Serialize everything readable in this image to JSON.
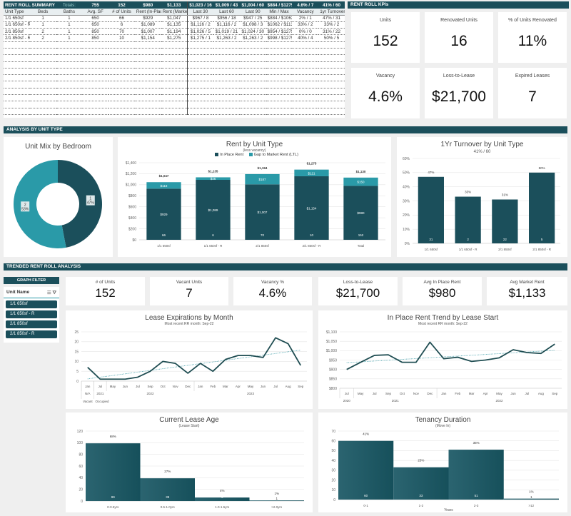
{
  "colors": {
    "dark_teal": "#1b4f5b",
    "light_teal": "#2a9aa8",
    "background": "#efefef"
  },
  "rent_roll": {
    "title": "RENT ROLL SUMMARY",
    "totals_label": "Totals:",
    "totals": [
      "755",
      "152",
      "$980",
      "$1,133",
      "$1,023 / 16",
      "$1,009 / 43",
      "$1,004 / 60",
      "$884 / $1275",
      "4.6% / 7",
      "41% / 60"
    ],
    "columns": [
      "Unit Type",
      "Beds",
      "Baths",
      "Avg. SF",
      "# of Units",
      "Rent (In-Place)",
      "Rent (Market)",
      "Last 30",
      "Last 60",
      "Last 90",
      "Min / Max",
      "Vacancy",
      "1yr Turnover"
    ],
    "rows": [
      [
        "1/1 650sf",
        "1",
        "1",
        "650",
        "66",
        "$929",
        "$1,047",
        "$967 / 8",
        "$956 / 18",
        "$947 / 25",
        "$884 / $1062",
        "2% / 1",
        "47% / 31"
      ],
      [
        "1/1 650sf - R",
        "1",
        "1",
        "650",
        "6",
        "$1,089",
        "$1,135",
        "$1,116 / 2",
        "$1,116 / 2",
        "$1,098 / 3",
        "$1062 / $1135",
        "33% / 2",
        "33% / 2"
      ],
      [
        "2/1 850sf",
        "2",
        "1",
        "850",
        "70",
        "$1,007",
        "$1,194",
        "$1,026 / 5",
        "$1,019 / 21",
        "$1,024 / 30",
        "$954 / $1275",
        "0% / 0",
        "31% / 22"
      ],
      [
        "2/1 850sf - R",
        "2",
        "1",
        "850",
        "10",
        "$1,154",
        "$1,275",
        "$1,275 / 1",
        "$1,263 / 2",
        "$1,263 / 2",
        "$998 / $1275",
        "40% / 4",
        "50% / 5"
      ]
    ]
  },
  "kpis": {
    "title": "RENT ROLL KPIs",
    "cards": [
      {
        "label": "Units",
        "value": "152"
      },
      {
        "label": "Renovated Units",
        "value": "16"
      },
      {
        "label": "% of Units Renovated",
        "value": "11%"
      },
      {
        "label": "Vacancy",
        "value": "4.6%"
      },
      {
        "label": "Loss-to-Lease",
        "value": "$21,700"
      },
      {
        "label": "Expired Leases",
        "value": "7"
      }
    ]
  },
  "section_unit_type": "ANALYSIS BY UNIT TYPE",
  "section_trended": "TRENDED RENT ROLL ANALYSIS",
  "graph_filter": {
    "title": "GRAPH FILTER",
    "field": "Unit Name",
    "items": [
      "1/1 650sf",
      "1/1 650sf - R",
      "2/1 850sf",
      "2/1 850sf - R"
    ]
  },
  "trend_kpis": [
    {
      "label": "# of Units",
      "value": "152"
    },
    {
      "label": "Vacant Units",
      "value": "7"
    },
    {
      "label": "Vacancy %",
      "value": "4.6%"
    },
    {
      "label": "Loss-to-Lease",
      "value": "$21,700"
    },
    {
      "label": "Avg In Place Rent",
      "value": "$980"
    },
    {
      "label": "Avg Market Rent",
      "value": "$1,133"
    }
  ],
  "chart_data": [
    {
      "id": "unit_mix",
      "type": "pie",
      "donut": true,
      "title": "Unit Mix by Bedroom",
      "categories": [
        "1",
        "2"
      ],
      "values": [
        47,
        53
      ],
      "labels": [
        "47%",
        "53%"
      ],
      "colors": [
        "#1b4f5b",
        "#2a9aa8"
      ]
    },
    {
      "id": "rent_by_type",
      "type": "bar",
      "stacked": true,
      "title": "Rent by Unit Type",
      "subtitle": "(less vacancy)",
      "legend_position": "top",
      "categories": [
        "1/1 650sf",
        "1/1 650sf - R",
        "2/1 850sf",
        "2/1 850sf - R",
        "Total"
      ],
      "series": [
        {
          "name": "In Place Rent",
          "values": [
            929,
            1089,
            1007,
            1154,
            980
          ],
          "labels": [
            "$929",
            "$1,089",
            "$1,007",
            "$1,154",
            "$980"
          ],
          "color": "#1b4f5b"
        },
        {
          "name": "Gap to Market Rent (LTL)",
          "values": [
            118,
            46,
            187,
            121,
            150
          ],
          "labels": [
            "$118",
            "$46",
            "$187",
            "$121",
            "$150"
          ],
          "color": "#2a9aa8"
        }
      ],
      "total_labels": [
        "$1,047",
        "$1,135",
        "$1,194",
        "$1,275",
        "$1,130"
      ],
      "unit_counts": [
        "66",
        "6",
        "70",
        "10",
        "152"
      ],
      "yticks": [
        "$0",
        "$200",
        "$400",
        "$600",
        "$800",
        "$1,000",
        "$1,200",
        "$1,400"
      ],
      "ylim": [
        0,
        1400
      ],
      "grid": true
    },
    {
      "id": "turnover",
      "type": "bar",
      "title": "1Yr Turnover by Unit Type",
      "subtitle": "41% / 60",
      "categories": [
        "1/1 650sf",
        "1/1 650sf - R",
        "2/1 850sf",
        "2/1 850sf - R"
      ],
      "values": [
        47,
        33,
        31,
        50
      ],
      "labels": [
        "47%",
        "33%",
        "31%",
        "50%"
      ],
      "counts": [
        "31",
        "2",
        "22",
        "5"
      ],
      "yticks": [
        "0%",
        "10%",
        "20%",
        "30%",
        "40%",
        "50%",
        "60%"
      ],
      "ylim": [
        0,
        60
      ],
      "grid": true
    },
    {
      "id": "lease_exp",
      "type": "line",
      "title": "Lease Expirations by Month",
      "subtitle": "Most recent RR month: Sep-22",
      "trendline": "linear",
      "x": [
        "Jan",
        "Jul",
        "May",
        "Jun",
        "Jul",
        "Sep",
        "Oct",
        "Nov",
        "Dec",
        "Jan",
        "Feb",
        "Mar",
        "Apr",
        "May",
        "Jun",
        "Jul",
        "Aug",
        "Sep"
      ],
      "x_groups": [
        {
          "label": "N/A",
          "span": 1
        },
        {
          "label": "2021",
          "span": 1
        },
        {
          "label": "2022",
          "span": 7
        },
        {
          "label": "2023",
          "span": 9
        }
      ],
      "x_groups2": [
        {
          "label": "Vacant",
          "span": 1
        },
        {
          "label": "Occupied",
          "span": 17
        }
      ],
      "values": [
        7,
        1,
        1,
        1,
        2,
        5,
        10,
        9,
        4,
        9,
        5,
        11,
        13,
        13,
        12,
        22,
        19,
        8
      ],
      "yticks": [
        "0",
        "5",
        "10",
        "15",
        "20",
        "25"
      ],
      "ylim": [
        0,
        25
      ],
      "grid": true
    },
    {
      "id": "rent_trend",
      "type": "line",
      "title": "In Place Rent Trend by Lease Start",
      "subtitle": "Most recent RR month: Sep-22",
      "trendline": "linear",
      "x": [
        "Jul",
        "May",
        "Jul",
        "Sep",
        "Oct",
        "Nov",
        "Dec",
        "Jan",
        "Feb",
        "Mar",
        "Apr",
        "May",
        "Jun",
        "Jul",
        "Aug",
        "Sep"
      ],
      "x_groups": [
        {
          "label": "2020",
          "span": 1
        },
        {
          "label": "2021",
          "span": 6
        },
        {
          "label": "2022",
          "span": 9
        }
      ],
      "values": [
        900,
        938,
        975,
        978,
        938,
        938,
        1045,
        957,
        965,
        943,
        950,
        962,
        1005,
        990,
        985,
        1035
      ],
      "yticks": [
        "$800",
        "$850",
        "$900",
        "$950",
        "$1,000",
        "$1,050",
        "$1,100"
      ],
      "ylim": [
        800,
        1100
      ],
      "grid": true
    },
    {
      "id": "lease_age",
      "type": "bar",
      "histogram": true,
      "title": "Current Lease Age",
      "subtitle": "(Lease Start)",
      "categories": [
        "0-0.5yrs",
        "0.5-1.0yrs",
        "1.0-1.5yrs",
        ">2.0yrs"
      ],
      "values": [
        99,
        39,
        6,
        1
      ],
      "labels": [
        "68%",
        "27%",
        "4%",
        "1%"
      ],
      "counts": [
        "99",
        "39",
        "6",
        "1"
      ],
      "yticks": [
        "0",
        "20",
        "40",
        "60",
        "80",
        "100",
        "120"
      ],
      "ylim": [
        0,
        120
      ],
      "grid": true
    },
    {
      "id": "tenancy",
      "type": "bar",
      "histogram": true,
      "title": "Tenancy Duration",
      "subtitle": "(Move In)",
      "xlabel": "Years",
      "categories": [
        "0-1",
        "1-2",
        "2-3",
        ">12"
      ],
      "values": [
        60,
        33,
        51,
        1
      ],
      "labels": [
        "41%",
        "23%",
        "35%",
        "1%"
      ],
      "counts": [
        "60",
        "33",
        "51",
        "1"
      ],
      "yticks": [
        "0",
        "10",
        "20",
        "30",
        "40",
        "50",
        "60",
        "70"
      ],
      "ylim": [
        0,
        70
      ],
      "grid": true
    }
  ]
}
